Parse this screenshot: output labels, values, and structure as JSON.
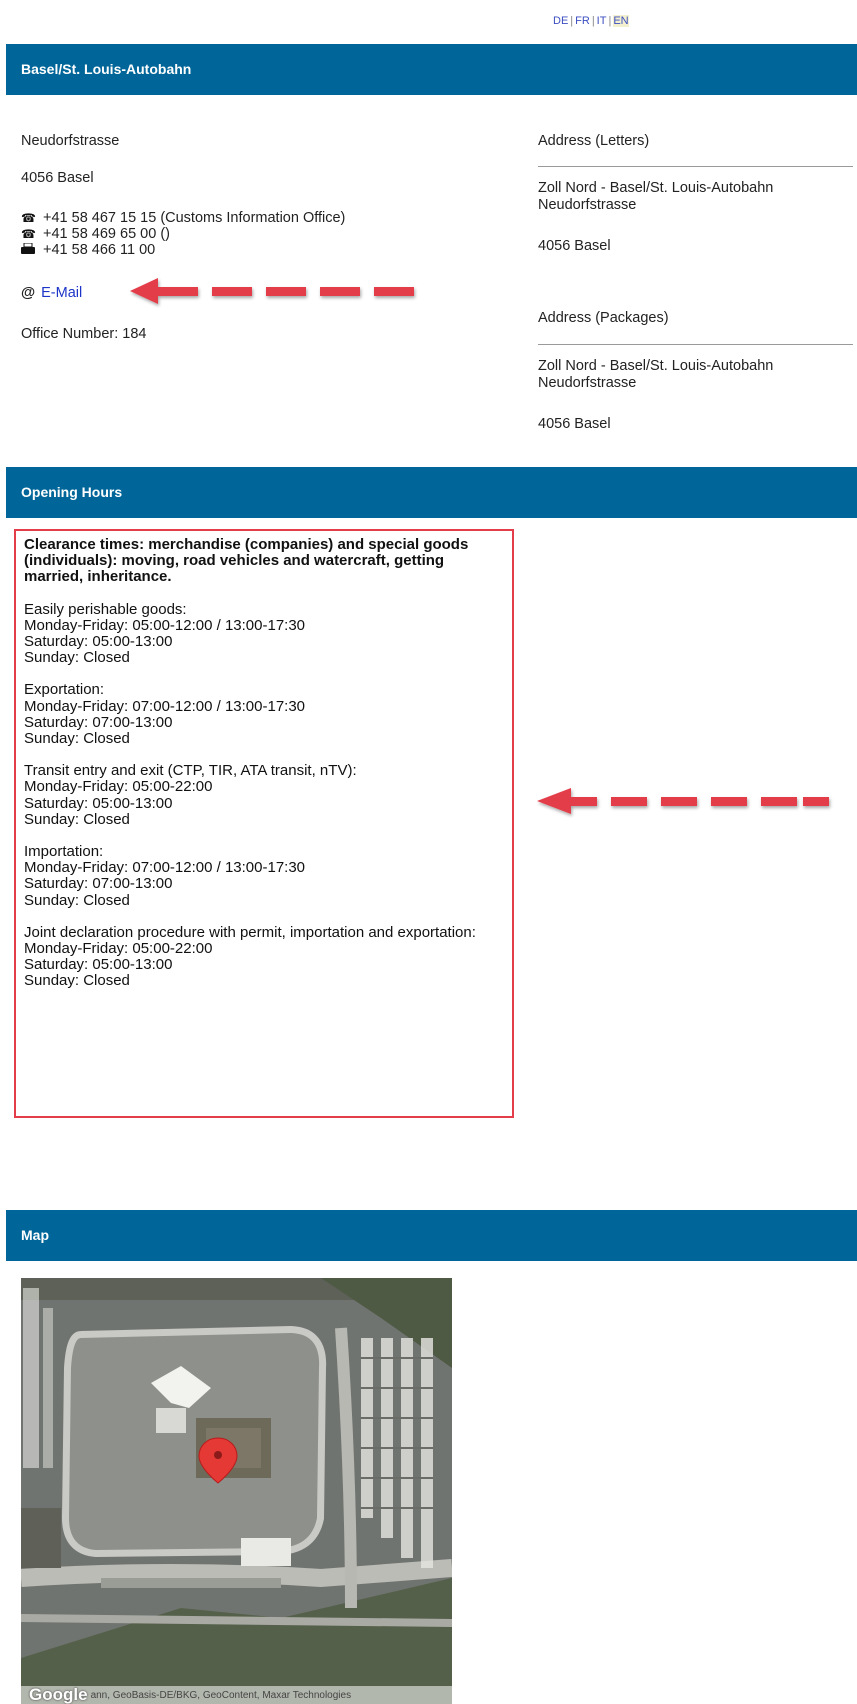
{
  "languages": [
    {
      "code": "DE"
    },
    {
      "code": "FR"
    },
    {
      "code": "IT"
    },
    {
      "code": "EN"
    }
  ],
  "office": {
    "title": "Basel/St. Louis-Autobahn",
    "street": "Neudorfstrasse",
    "city": "4056 Basel",
    "phones": [
      {
        "icon": "phone-icon",
        "text": "+41 58 467 15 15 (Customs Information Office)"
      },
      {
        "icon": "phone-icon",
        "text": "+41 58 469 65 00 ()"
      },
      {
        "icon": "fax-icon",
        "text": "+41 58 466 11 00"
      }
    ],
    "email_symbol": "@",
    "email_label": "E-Mail",
    "office_number": "Office Number: 184"
  },
  "address_letters": {
    "heading": "Address (Letters)",
    "line1": "Zoll Nord - Basel/St. Louis-Autobahn",
    "line2": "Neudorfstrasse",
    "line3": "4056 Basel"
  },
  "address_packages": {
    "heading": "Address (Packages)",
    "line1": "Zoll Nord - Basel/St. Louis-Autobahn",
    "line2": "Neudorfstrasse",
    "line3": "4056 Basel"
  },
  "opening_hours": {
    "title": "Opening Hours",
    "heading": "Clearance times: merchandise (companies) and special goods (individuals): moving, road vehicles and watercraft, getting married, inheritance.",
    "sections": [
      {
        "name": "Easily perishable goods:",
        "lines": [
          "Monday-Friday: 05:00-12:00 / 13:00-17:30",
          "Saturday: 05:00-13:00",
          "Sunday: Closed"
        ]
      },
      {
        "name": "Exportation:",
        "lines": [
          "Monday-Friday: 07:00-12:00 / 13:00-17:30",
          "Saturday: 07:00-13:00",
          "Sunday: Closed"
        ]
      },
      {
        "name": "Transit entry and exit (CTP, TIR, ATA transit, nTV):",
        "lines": [
          "Monday-Friday: 05:00-22:00",
          "Saturday: 05:00-13:00",
          "Sunday: Closed"
        ]
      },
      {
        "name": "Importation:",
        "lines": [
          "Monday-Friday: 07:00-12:00 / 13:00-17:30",
          "Saturday: 07:00-13:00",
          "Sunday: Closed"
        ]
      },
      {
        "name": "Joint declaration procedure with permit, importation and exportation:",
        "lines": [
          "Monday-Friday: 05:00-22:00",
          "Saturday: 05:00-13:00",
          "Sunday: Closed"
        ]
      }
    ]
  },
  "map": {
    "title": "Map",
    "logo": "Google",
    "attribution": "ann, GeoBasis-DE/BKG, GeoContent, Maxar Technologies"
  },
  "colors": {
    "header_bar": "#006699",
    "highlight": "#e33d4a",
    "link": "#1b35c9"
  }
}
